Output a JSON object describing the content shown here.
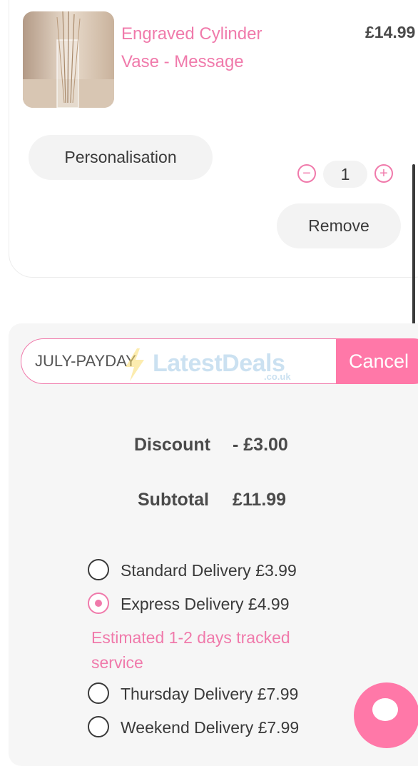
{
  "cart_item": {
    "name": "Engraved Cylinder Vase - Message",
    "price": "£14.99",
    "personalisation_label": "Personalisation",
    "quantity": "1",
    "remove_label": "Remove"
  },
  "voucher": {
    "code": "JULY-PAYDAY",
    "cancel_label": "Cancel"
  },
  "watermark": {
    "text": "LatestDeals",
    "sub": ".co.uk"
  },
  "summary": {
    "discount_label": "Discount",
    "discount_value": "- £3.00",
    "subtotal_label": "Subtotal",
    "subtotal_value": "£11.99"
  },
  "delivery_options": [
    {
      "label": "Standard Delivery £3.99",
      "selected": false
    },
    {
      "label": "Express Delivery £4.99",
      "selected": true
    },
    {
      "label": "Thursday Delivery £7.99",
      "selected": false
    },
    {
      "label": "Weekend Delivery £7.99",
      "selected": false
    }
  ],
  "delivery_note": "Estimated 1-2 days tracked service",
  "colors": {
    "accent": "#f07aab",
    "button_pink": "#ff78a8"
  }
}
